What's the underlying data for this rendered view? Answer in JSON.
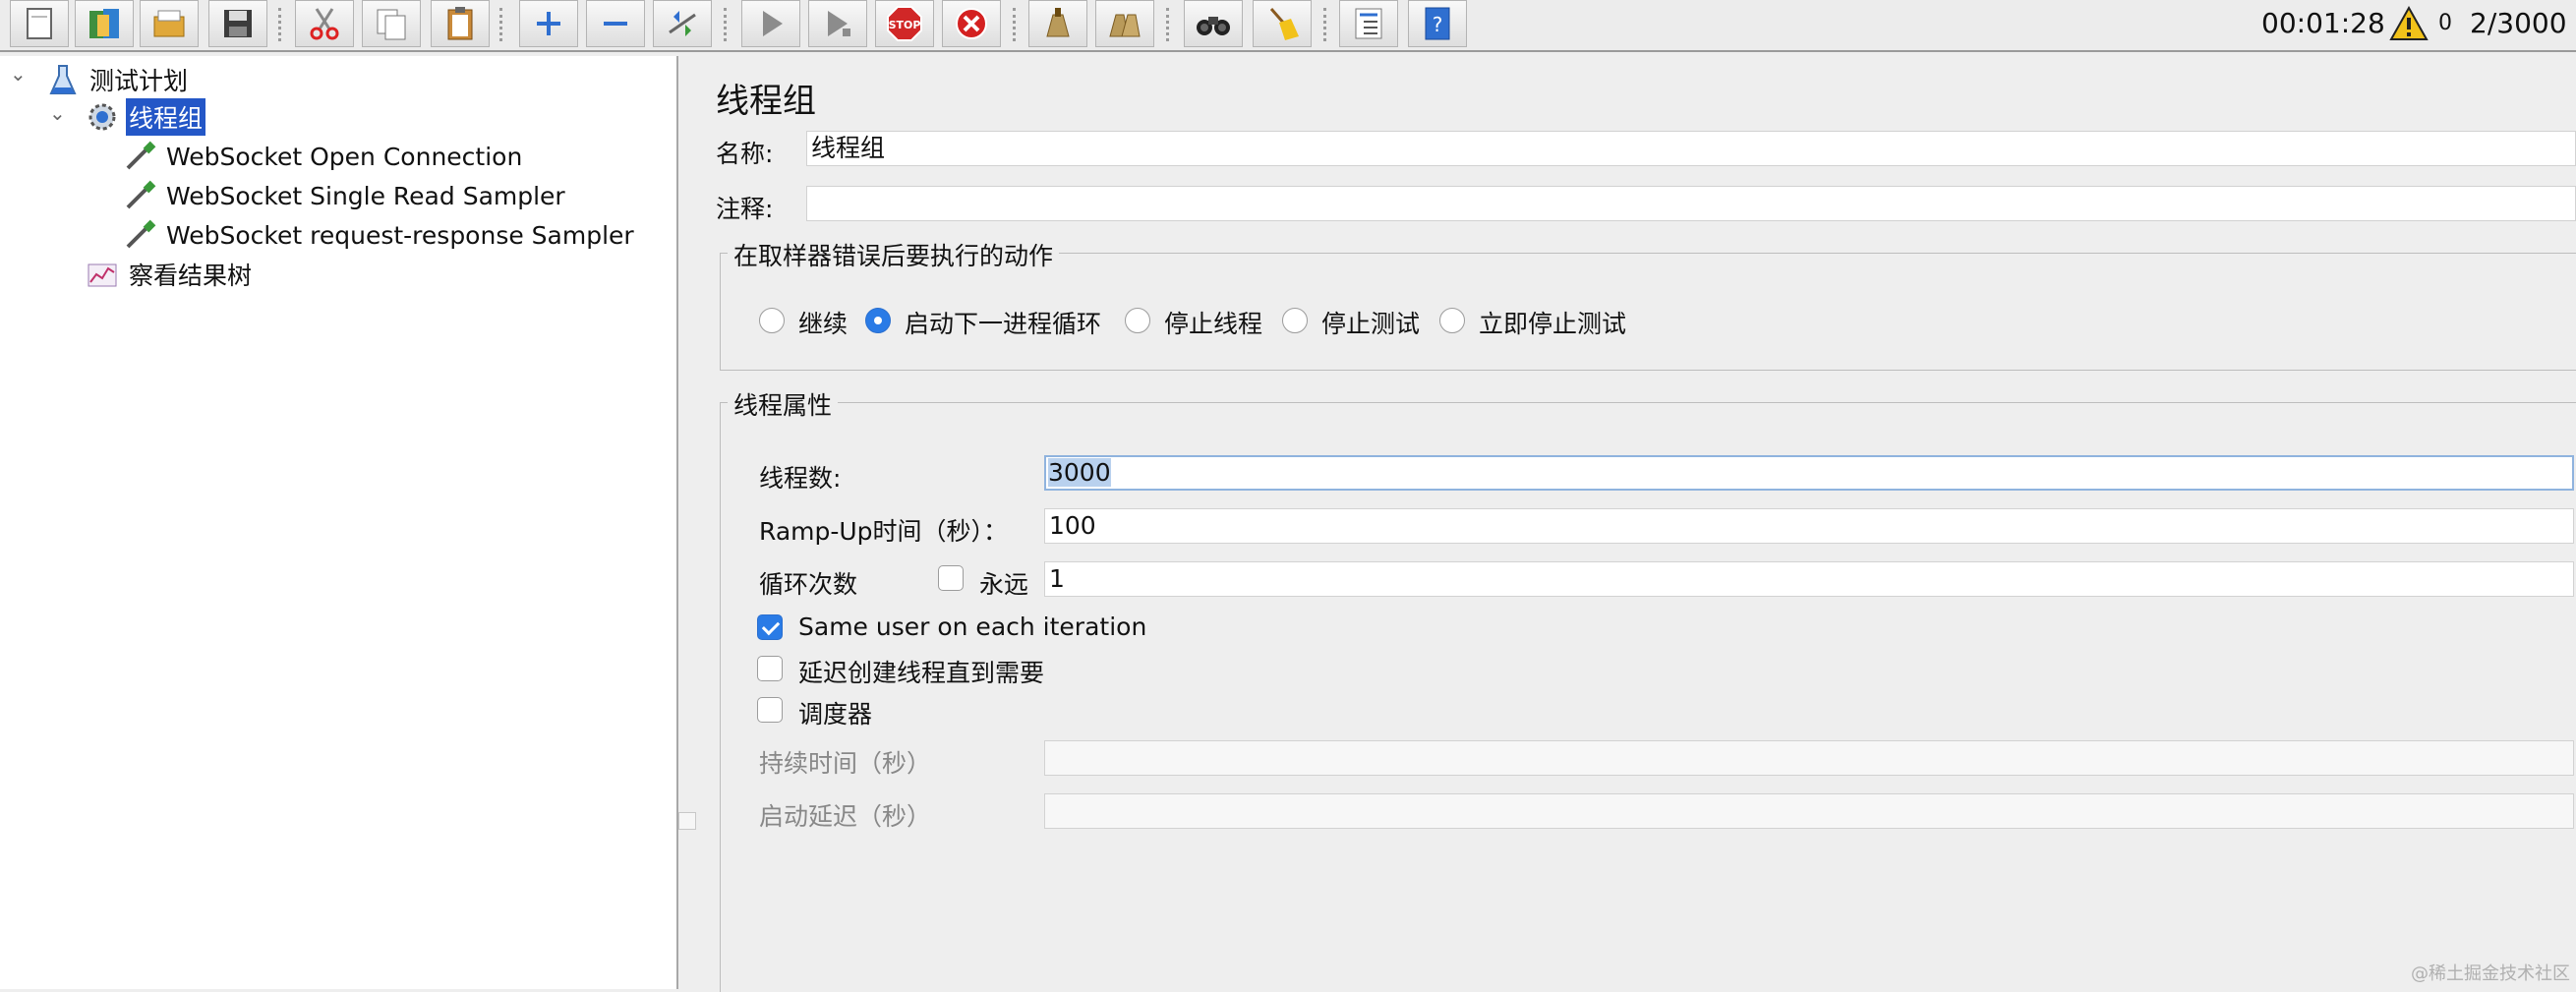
{
  "toolbar": {
    "buttons": [
      {
        "icon": "new-document-icon"
      },
      {
        "icon": "templates-icon"
      },
      {
        "icon": "open-folder-icon"
      },
      {
        "icon": "save-icon"
      },
      {
        "icon": "cut-icon"
      },
      {
        "icon": "copy-icon"
      },
      {
        "icon": "paste-icon"
      },
      {
        "icon": "expand-plus-icon"
      },
      {
        "icon": "collapse-minus-icon"
      },
      {
        "icon": "toggle-icon"
      },
      {
        "icon": "start-icon"
      },
      {
        "icon": "start-no-pauses-icon"
      },
      {
        "icon": "stop-icon"
      },
      {
        "icon": "shutdown-icon"
      },
      {
        "icon": "clear-icon"
      },
      {
        "icon": "clear-all-icon"
      },
      {
        "icon": "search-binoculars-icon"
      },
      {
        "icon": "reset-search-broom-icon"
      },
      {
        "icon": "function-helper-icon"
      },
      {
        "icon": "help-icon"
      }
    ],
    "stop_text": "STOP",
    "help_text": "?",
    "status": {
      "elapsed_time": "00:01:28",
      "warning_count": "0",
      "active_threads": "2/3000"
    }
  },
  "tree": {
    "items": [
      {
        "label": "测试计划",
        "icon": "test-plan-flask-icon"
      },
      {
        "label": "线程组",
        "icon": "thread-group-gear-icon",
        "selected": true
      },
      {
        "label": "WebSocket Open Connection",
        "icon": "sampler-pipette-icon"
      },
      {
        "label": "WebSocket Single Read Sampler",
        "icon": "sampler-pipette-icon"
      },
      {
        "label": "WebSocket request-response Sampler",
        "icon": "sampler-pipette-icon"
      },
      {
        "label": "察看结果树",
        "icon": "listener-graph-icon"
      }
    ]
  },
  "panel": {
    "title": "线程组",
    "name_label": "名称:",
    "name_value": "线程组",
    "comment_label": "注释:",
    "comment_value": "",
    "error_action": {
      "title": "在取样器错误后要执行的动作",
      "options": [
        "继续",
        "启动下一进程循环",
        "停止线程",
        "停止测试",
        "立即停止测试"
      ],
      "selected": "启动下一进程循环"
    },
    "thread_props": {
      "title": "线程属性",
      "threads_label": "线程数:",
      "threads_value": "3000",
      "rampup_label": "Ramp-Up时间（秒）：",
      "rampup_value": "100",
      "loop_label": "循环次数",
      "forever_label": "永远",
      "forever_checked": false,
      "loop_value": "1",
      "same_user_label": "Same user on each iteration",
      "same_user_checked": true,
      "delay_label": "延迟创建线程直到需要",
      "delay_checked": false,
      "scheduler_label": "调度器",
      "scheduler_checked": false,
      "duration_label": "持续时间（秒）",
      "duration_value": "",
      "startup_delay_label": "启动延迟（秒）",
      "startup_delay_value": ""
    }
  },
  "watermark": "@稀土掘金技术社区"
}
